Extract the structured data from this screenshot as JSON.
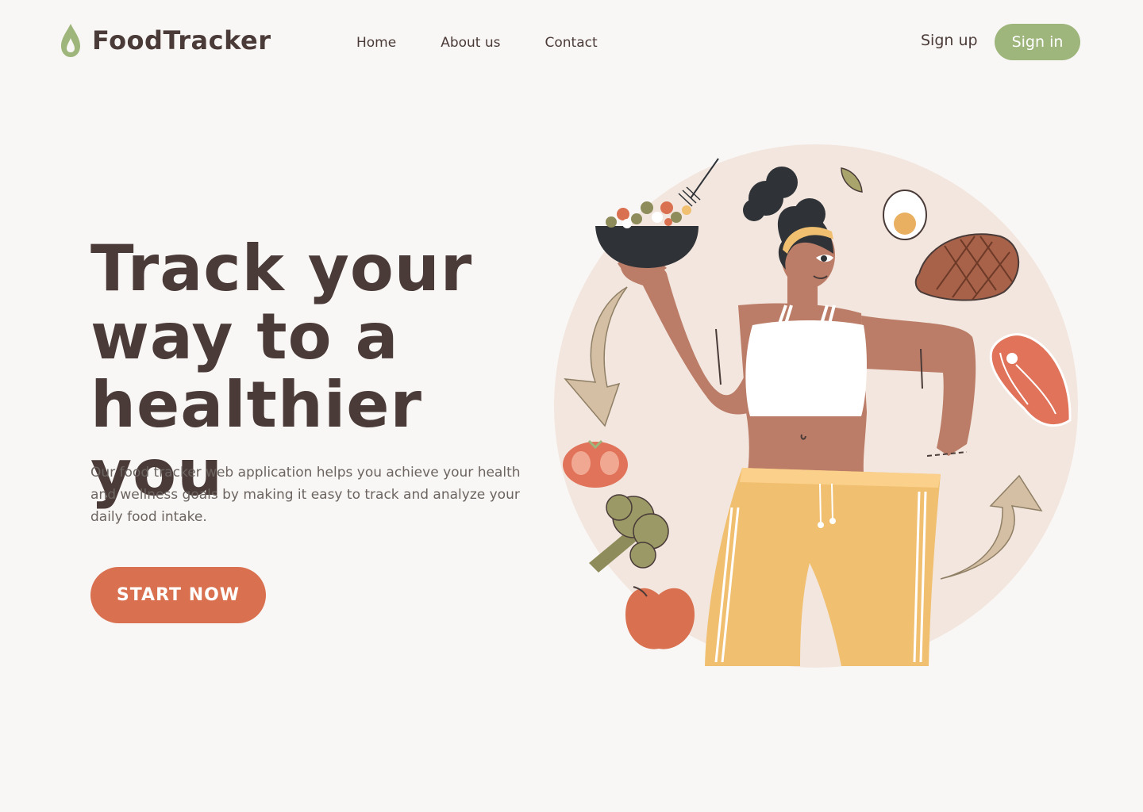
{
  "brand": {
    "name": "FoodTracker",
    "colors": {
      "primary_text": "#4a3b38",
      "accent_green": "#9eb57c",
      "accent_orange": "#d97050",
      "background": "#f9f7f5"
    }
  },
  "nav": {
    "items": [
      {
        "label": "Home"
      },
      {
        "label": "About us"
      },
      {
        "label": "Contact"
      }
    ]
  },
  "auth": {
    "signup_label": "Sign up",
    "signin_label": "Sign in"
  },
  "hero": {
    "title_line1": "Track your",
    "title_line2": "way to a",
    "title_line3": "healthier you",
    "description": "Our food tracker web application helps you achieve your health and wellness goals by making it easy to track and analyze your daily food intake.",
    "cta_label": "START NOW"
  },
  "illustration": {
    "icons": [
      "salad-bowl-icon",
      "egg-icon",
      "steak-icon",
      "salmon-icon",
      "tomato-icon",
      "broccoli-icon",
      "apple-icon",
      "leaf-icon",
      "arrow-down-icon",
      "arrow-up-icon"
    ]
  }
}
